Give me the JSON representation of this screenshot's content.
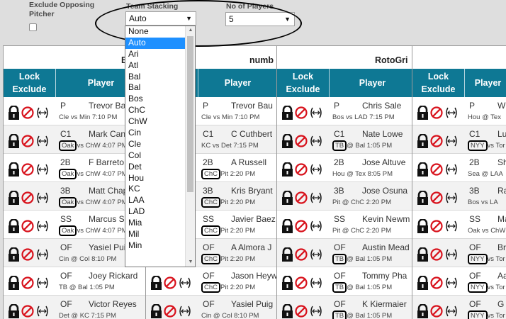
{
  "top": {
    "exclude_label": "Exclude Opposing Pitcher",
    "stack_label": "Team Stacking",
    "stack_value": "Auto",
    "players_label": "No of Players",
    "players_value": "5"
  },
  "dropdown": {
    "options": [
      "None",
      "Auto",
      "Ari",
      "Atl",
      "Bal",
      "Bal",
      "Bos",
      "ChC",
      "ChW",
      "Cin",
      "Cle",
      "Col",
      "Det",
      "Hou",
      "KC",
      "LAA",
      "LAD",
      "Mia",
      "Mil",
      "Min"
    ],
    "selected_index": 1
  },
  "headers": {
    "lock": "Lock Exclude",
    "player": "Player"
  },
  "panels": [
    {
      "title": "Ba",
      "rows": [
        {
          "pos": "P",
          "name": "Trevor Bau",
          "team": "",
          "game": "Cle vs Min 7:10 PM"
        },
        {
          "pos": "C1",
          "name": "Mark Can",
          "team": "Oak",
          "game": "vs ChW 4:07 PM"
        },
        {
          "pos": "2B",
          "name": "F Barreto",
          "team": "Oak",
          "game": "vs ChW 4:07 PM"
        },
        {
          "pos": "3B",
          "name": "Matt Chap",
          "team": "Oak",
          "game": "vs ChW 4:07 PM"
        },
        {
          "pos": "SS",
          "name": "Marcus S",
          "team": "Oak",
          "game": "vs ChW 4:07 PM"
        },
        {
          "pos": "OF",
          "name": "Yasiel Pui",
          "team": "",
          "game": "Cin @ Col 8:10 PM"
        },
        {
          "pos": "OF",
          "name": "Joey Rickard",
          "team": "",
          "game": "TB @ Bal 1:05 PM"
        },
        {
          "pos": "OF",
          "name": "Victor Reyes",
          "team": "",
          "game": "Det @ KC 7:15 PM"
        }
      ]
    },
    {
      "title": "numb",
      "rows": [
        {
          "pos": "P",
          "name": "Trevor Bau",
          "team": "",
          "game": "Cle vs Min 7:10 PM"
        },
        {
          "pos": "C1",
          "name": "C Cuthbert",
          "team": "",
          "game": "KC vs Det 7:15 PM"
        },
        {
          "pos": "2B",
          "name": "A Russell",
          "team": "ChC",
          "game": "Pit 2:20 PM"
        },
        {
          "pos": "3B",
          "name": "Kris Bryant",
          "team": "ChC",
          "game": "Pit 2:20 PM"
        },
        {
          "pos": "SS",
          "name": "Javier Baez",
          "team": "ChC",
          "game": "Pit 2:20 PM"
        },
        {
          "pos": "OF",
          "name": "A Almora J",
          "team": "ChC",
          "game": "Pit 2:20 PM"
        },
        {
          "pos": "OF",
          "name": "Jason Heyw",
          "team": "ChC",
          "game": "Pit 2:20 PM"
        },
        {
          "pos": "OF",
          "name": "Yasiel Puig",
          "team": "",
          "game": "Cin @ Col 8:10 PM"
        }
      ]
    },
    {
      "title": "RotoGri",
      "rows": [
        {
          "pos": "P",
          "name": "Chris Sale",
          "team": "",
          "game": "Bos vs LAD 7:15 PM"
        },
        {
          "pos": "C1",
          "name": "Nate Lowe",
          "team": "TB",
          "game": "@ Bal 1:05 PM"
        },
        {
          "pos": "2B",
          "name": "Jose Altuve",
          "team": "",
          "game": "Hou @ Tex 8:05 PM"
        },
        {
          "pos": "3B",
          "name": "Jose Osuna",
          "team": "",
          "game": "Pit @ ChC 2:20 PM"
        },
        {
          "pos": "SS",
          "name": "Kevin Newm",
          "team": "",
          "game": "Pit @ ChC 2:20 PM"
        },
        {
          "pos": "OF",
          "name": "Austin Mead",
          "team": "TB",
          "game": "@ Bal 1:05 PM"
        },
        {
          "pos": "OF",
          "name": "Tommy Pha",
          "team": "TB",
          "game": "@ Bal 1:05 PM"
        },
        {
          "pos": "OF",
          "name": "K Kiermaier",
          "team": "TB",
          "game": "@ Bal 1:05 PM"
        }
      ]
    },
    {
      "title": "D",
      "rows": [
        {
          "pos": "P",
          "name": "W",
          "team": "",
          "game": "Hou @ Tex"
        },
        {
          "pos": "C1",
          "name": "Lu",
          "team": "NYY",
          "game": "vs Tor"
        },
        {
          "pos": "2B",
          "name": "Sh",
          "team": "",
          "game": "Sea @ LAA"
        },
        {
          "pos": "3B",
          "name": "Ra",
          "team": "",
          "game": "Bos vs LA"
        },
        {
          "pos": "SS",
          "name": "Ma",
          "team": "",
          "game": "Oak vs ChW"
        },
        {
          "pos": "OF",
          "name": "Br",
          "team": "NYY",
          "game": "vs Tor"
        },
        {
          "pos": "OF",
          "name": "Aa",
          "team": "NYY",
          "game": "vs Tor"
        },
        {
          "pos": "OF",
          "name": "G",
          "team": "NYY",
          "game": "vs Tor"
        }
      ]
    }
  ]
}
